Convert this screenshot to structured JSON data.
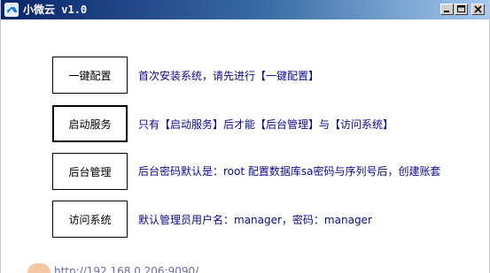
{
  "window": {
    "title": "小微云 v1.0"
  },
  "actions": [
    {
      "label": "一键配置",
      "description": "首次安装系统，请先进行【一键配置】"
    },
    {
      "label": "启动服务",
      "description": "只有【启动服务】后才能【后台管理】与【访问系统】"
    },
    {
      "label": "后台管理",
      "description": "后台密码默认是：root 配置数据库sa密码与序列号后，创建账套"
    },
    {
      "label": "访问系统",
      "description": "默认管理员用户名：manager，密码：manager"
    }
  ],
  "footer": {
    "link_text": "http://192.168.0.206:9090/"
  },
  "colors": {
    "titlebar_start": "#0a246a",
    "titlebar_end": "#a6caf0",
    "description_text": "#0a0a8c"
  }
}
